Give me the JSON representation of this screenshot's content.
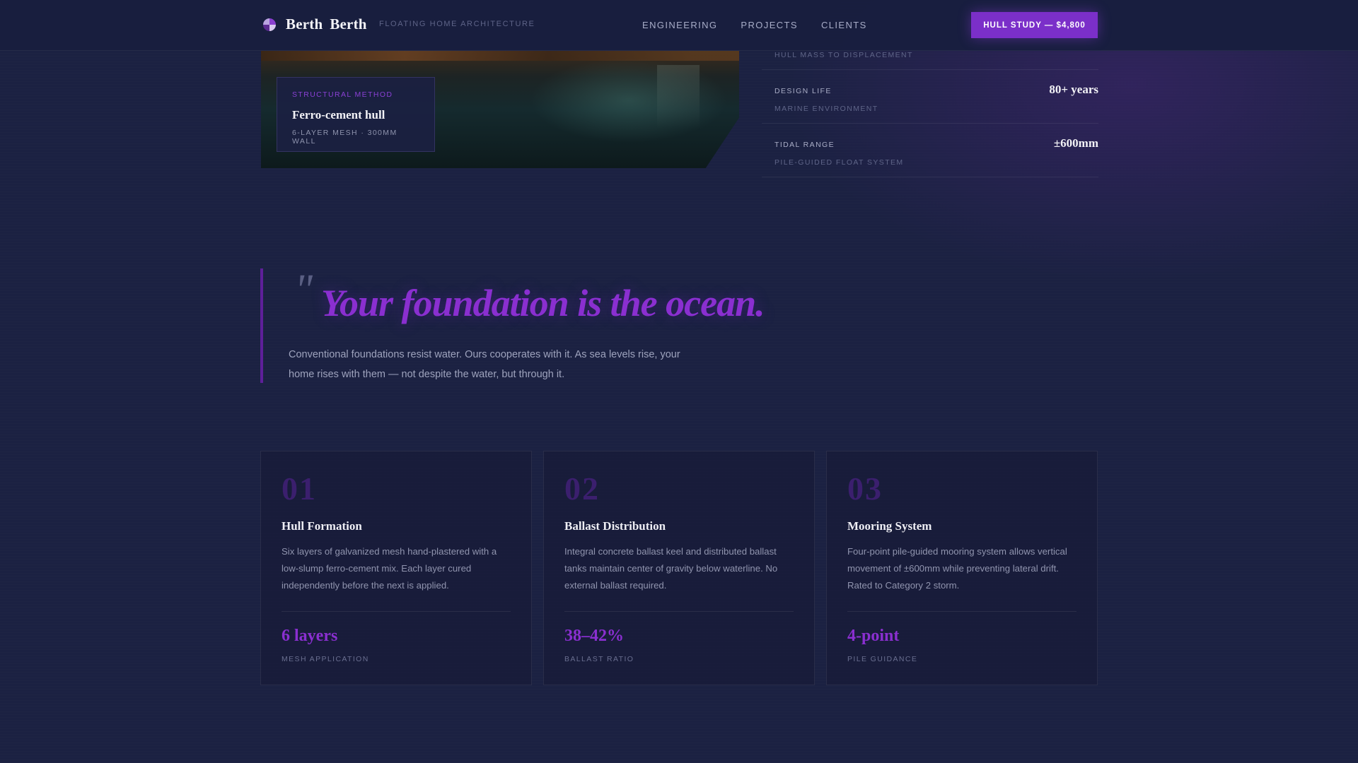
{
  "nav": {
    "brand_word1": "Berth",
    "brand_word2": "Berth",
    "tagline": "FLOATING HOME ARCHITECTURE",
    "links": [
      "ENGINEERING",
      "PROJECTS",
      "CLIENTS"
    ],
    "cta_label": "HULL STUDY — $4,800"
  },
  "hero": {
    "method_label": "STRUCTURAL METHOD",
    "method_title": "Ferro-cement hull",
    "method_sub": "6-LAYER MESH · 300MM WALL"
  },
  "stats": [
    {
      "label": "",
      "sub": "HULL MASS TO DISPLACEMENT",
      "value": ""
    },
    {
      "label": "DESIGN LIFE",
      "sub": "MARINE ENVIRONMENT",
      "value": "80+ years"
    },
    {
      "label": "TIDAL RANGE",
      "sub": "PILE-GUIDED FLOAT SYSTEM",
      "value": "±600mm"
    }
  ],
  "quote": {
    "mark": "\"",
    "text": "Your foundation is the ocean.",
    "body": "Conventional foundations resist water. Ours cooperates with it. As sea levels rise, your home rises with them — not despite the water, but through it."
  },
  "cards": [
    {
      "num": "01",
      "title": "Hull Formation",
      "body": "Six layers of galvanized mesh hand-plastered with a low-slump ferro-cement mix. Each layer cured independently before the next is applied.",
      "metric": "6 layers",
      "metric_label": "MESH APPLICATION"
    },
    {
      "num": "02",
      "title": "Ballast Distribution",
      "body": "Integral concrete ballast keel and distributed ballast tanks maintain center of gravity below waterline. No external ballast required.",
      "metric": "38–42%",
      "metric_label": "BALLAST RATIO"
    },
    {
      "num": "03",
      "title": "Mooring System",
      "body": "Four-point pile-guided mooring system allows vertical movement of ±600mm while preventing lateral drift. Rated to Category 2 storm.",
      "metric": "4-point",
      "metric_label": "PILE GUIDANCE"
    }
  ],
  "colors": {
    "accent": "#7b2fc9",
    "background": "#1b2142"
  }
}
